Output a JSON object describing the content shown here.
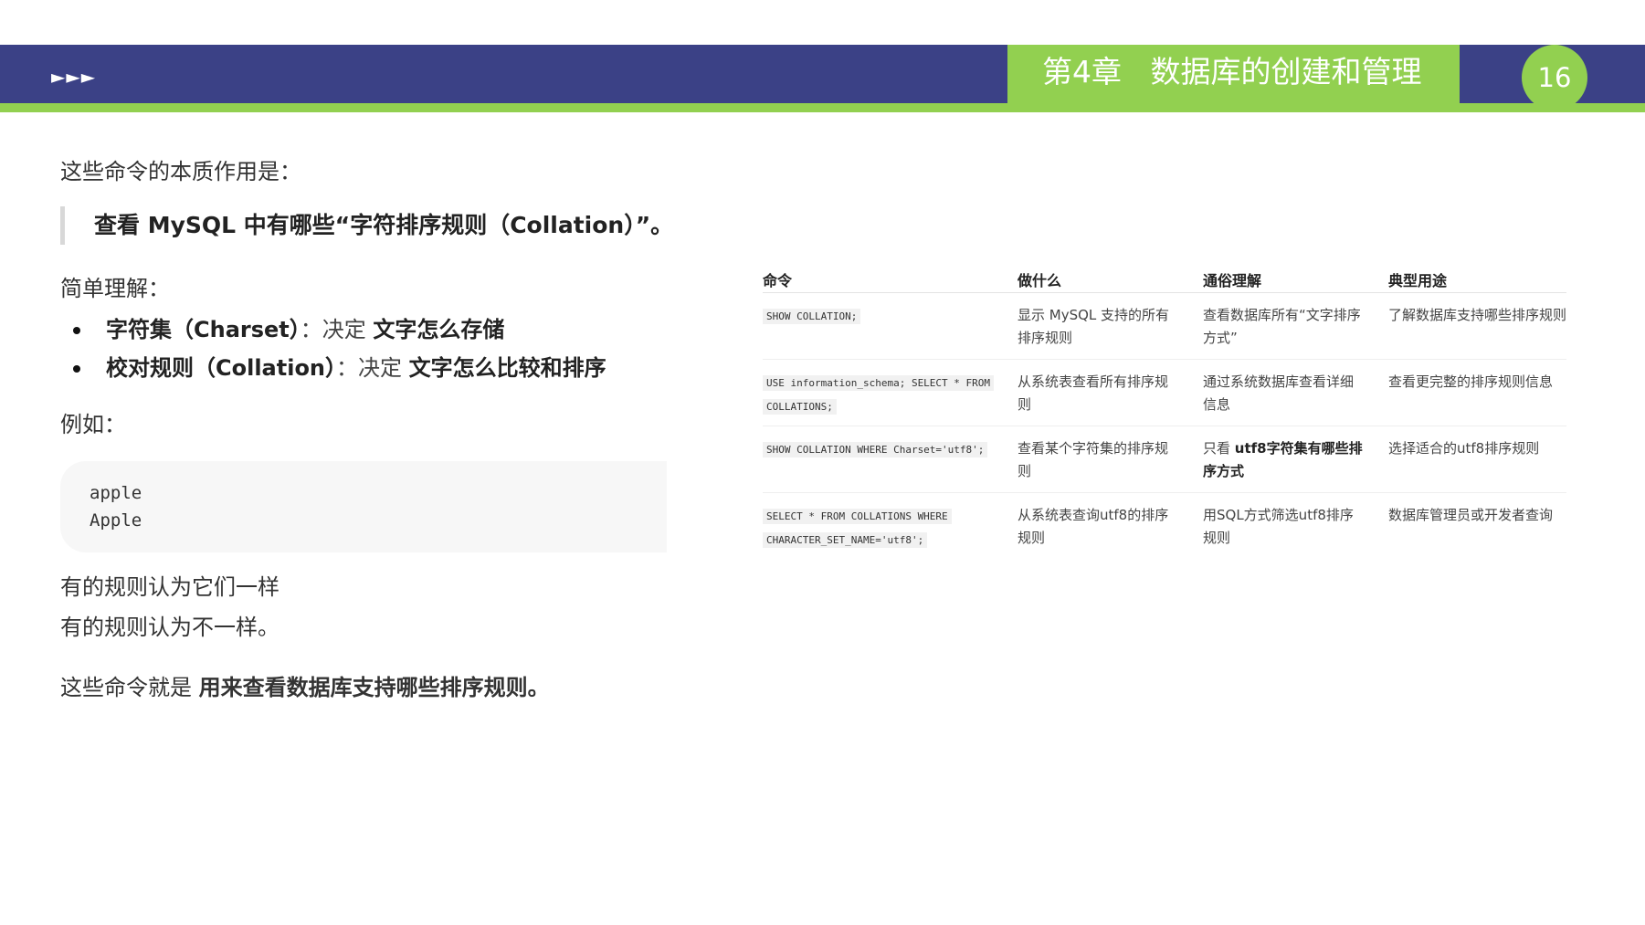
{
  "header": {
    "arrows": "►►►",
    "chapter_title": "第4章   数据库的创建和管理",
    "page_number": "16",
    "colors": {
      "bar": "#3b4186",
      "accent": "#92d050"
    }
  },
  "content": {
    "intro": "这些命令的本质作用是：",
    "quote": "查看 MySQL 中有哪些“字符排序规则（Collation）”。",
    "simple": "简单理解：",
    "bullets": [
      {
        "term": "字符集（Charset）",
        "sep": "：决定 ",
        "desc": "文字怎么存储"
      },
      {
        "term": "校对规则（Collation）",
        "sep": "：决定 ",
        "desc": "文字怎么比较和排序"
      }
    ],
    "example": "例如：",
    "code_lines": [
      "apple",
      "Apple"
    ],
    "after1": "有的规则认为它们一样",
    "after2": "有的规则认为不一样。",
    "summary_prefix": "这些命令就是 ",
    "summary_bold": "用来查看数据库支持哪些排序规则。"
  },
  "table": {
    "headers": [
      "命令",
      "做什么",
      "通俗理解",
      "典型用途"
    ],
    "rows": [
      {
        "command": "SHOW COLLATION;",
        "what": "显示 MySQL 支持的所有排序规则",
        "plain": "查看数据库所有“文字排序方式”",
        "use": "了解数据库支持哪些排序规则"
      },
      {
        "command": "USE information_schema; SELECT * FROM COLLATIONS;",
        "what": "从系统表查看所有排序规则",
        "plain": "通过系统数据库查看详细信息",
        "use": "查看更完整的排序规则信息"
      },
      {
        "command": "SHOW COLLATION WHERE Charset='utf8';",
        "what": "查看某个字符集的排序规则",
        "plain_prefix": "只看 ",
        "plain_bold": "utf8字符集有哪些排序方式",
        "use": "选择适合的utf8排序规则"
      },
      {
        "command": "SELECT * FROM COLLATIONS WHERE CHARACTER_SET_NAME='utf8';",
        "what": "从系统表查询utf8的排序规则",
        "plain": "用SQL方式筛选utf8排序规则",
        "use": "数据库管理员或开发者查询"
      }
    ]
  }
}
